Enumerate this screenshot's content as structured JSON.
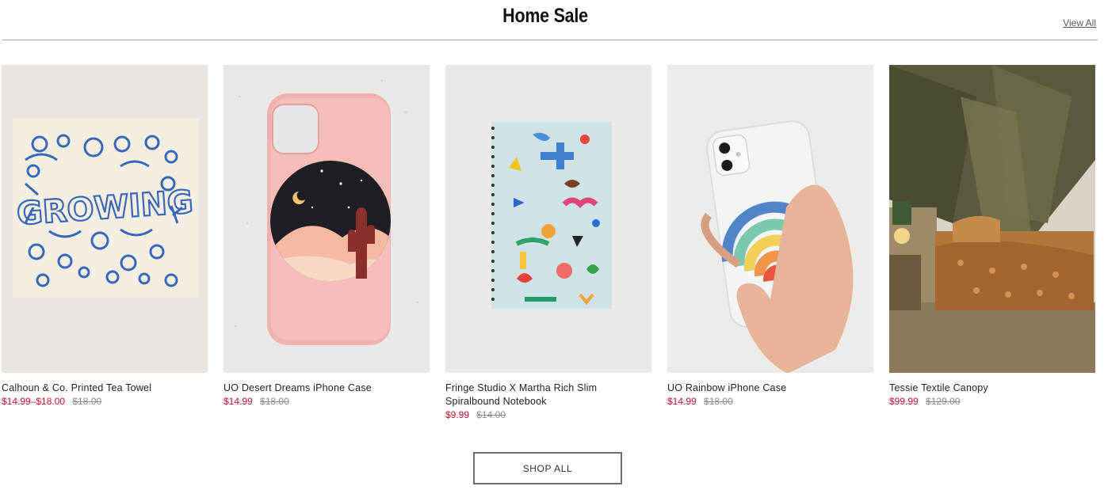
{
  "header": {
    "title": "Home Sale",
    "view_all_label": "View All"
  },
  "products": [
    {
      "name": "Calhoun & Co. Printed Tea Towel",
      "sale_price": "$14.99–$18.00",
      "original_price": "$18.00",
      "image_text": "GROWING",
      "image_icon": "tea-towel-image"
    },
    {
      "name": "UO Desert Dreams iPhone Case",
      "sale_price": "$14.99",
      "original_price": "$18.00",
      "image_icon": "desert-phone-case-image"
    },
    {
      "name": "Fringe Studio X Martha Rich Slim Spiralbound Notebook",
      "sale_price": "$9.99",
      "original_price": "$14.00",
      "image_icon": "notebook-image"
    },
    {
      "name": "UO Rainbow iPhone Case",
      "sale_price": "$14.99",
      "original_price": "$18.00",
      "image_icon": "rainbow-phone-case-image"
    },
    {
      "name": "Tessie Textile Canopy",
      "sale_price": "$99.99",
      "original_price": "$129.00",
      "image_icon": "canopy-image"
    }
  ],
  "footer": {
    "shop_all_label": "SHOP ALL"
  },
  "colors": {
    "sale_price": "#c8102e",
    "original_price": "#8a8a8a",
    "divider": "#a6a6a6"
  }
}
